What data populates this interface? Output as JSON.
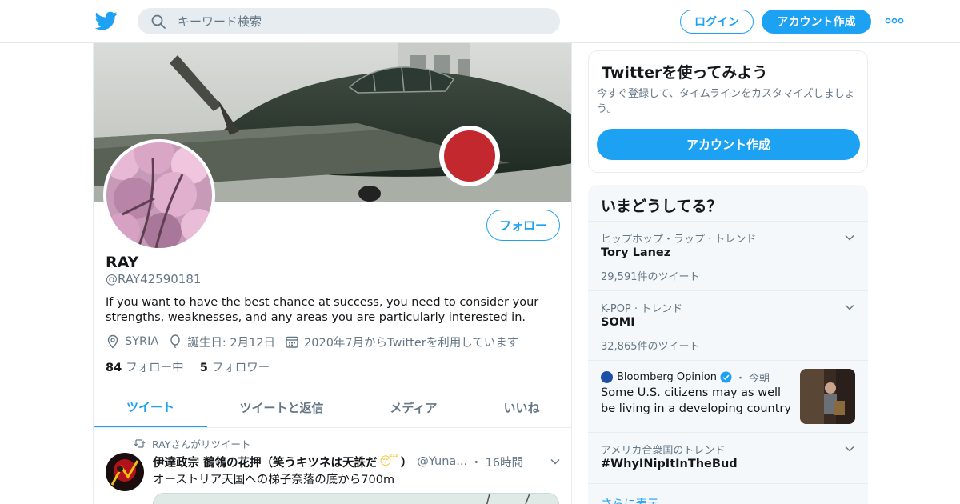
{
  "header": {
    "search_placeholder": "キーワード検索",
    "login_label": "ログイン",
    "signup_label": "アカウント作成",
    "brand_color": "#1da1f2"
  },
  "profile": {
    "display_name": "RAY",
    "handle": "@RAY42590181",
    "bio": "If you want to have the best chance at success, you need to consider your strengths, weaknesses, and any areas you are particularly interested in.",
    "follow_button": "フォロー",
    "location": "SYRIA",
    "birthday": "誕生日: 2月12日",
    "joined": "2020年7月からTwitterを利用しています",
    "following_count": "84",
    "following_label": "フォロー中",
    "followers_count": "5",
    "followers_label": "フォロワー"
  },
  "tabs": [
    {
      "label": "ツイート",
      "active": true
    },
    {
      "label": "ツイートと返信",
      "active": false
    },
    {
      "label": "メディア",
      "active": false
    },
    {
      "label": "いいね",
      "active": false
    }
  ],
  "tweet": {
    "retweet_context": "RAYさんがリツイート",
    "author_name": "伊達政宗 鶺鴒の花押（笑うキツネは天誅だ",
    "author_emoji": "😴",
    "author_name_end": "）",
    "author_handle": "@Yuna...",
    "separator": "・",
    "time": "16時間",
    "text": "オーストリア天国への梯子奈落の底から700m"
  },
  "signup_card": {
    "title": "Twitterを使ってみよう",
    "description": "今すぐ登録して、タイムラインをカスタマイズしましょう。",
    "button": "アカウント作成"
  },
  "trends": {
    "title": "いまどうしてる？",
    "items": [
      {
        "context": "ヒップホップ・ラップ · トレンド",
        "name": "Tory Lanez",
        "count": "29,591件のツイート"
      },
      {
        "context": "K-POP · トレンド",
        "name": "SOMI",
        "count": "32,865件のツイート"
      }
    ],
    "news": {
      "source": "Bloomberg Opinion",
      "separator": "・",
      "time": "今朝",
      "headline": "Some U.S. citizens may as well be living in a developing country"
    },
    "last": {
      "context": "アメリカ合衆国のトレンド",
      "name": "#WhyINipItInTheBud"
    },
    "show_more": "さらに表示"
  }
}
